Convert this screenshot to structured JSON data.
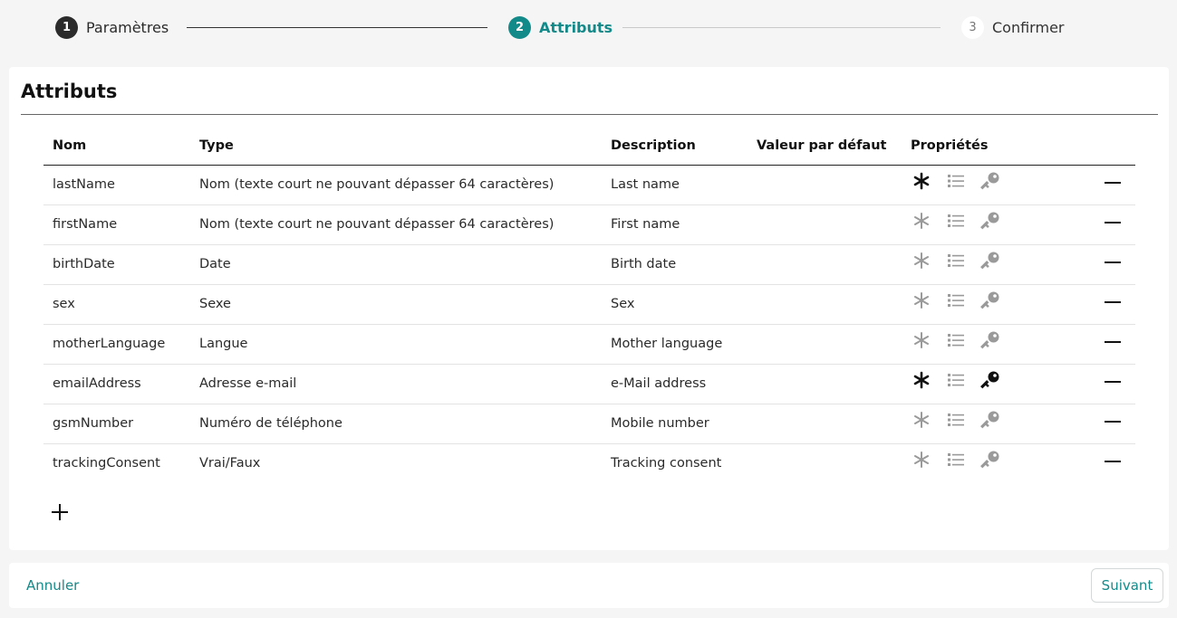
{
  "stepper": {
    "steps": [
      {
        "num": "1",
        "label": "Paramètres",
        "state": "done"
      },
      {
        "num": "2",
        "label": "Attributs",
        "state": "active"
      },
      {
        "num": "3",
        "label": "Confirmer",
        "state": "todo"
      }
    ]
  },
  "card": {
    "title": "Attributs",
    "columns": {
      "name": "Nom",
      "type": "Type",
      "description": "Description",
      "default": "Valeur par défaut",
      "properties": "Propriétés"
    },
    "rows": [
      {
        "name": "lastName",
        "type": "Nom (texte court ne pouvant dépasser 64 caractères)",
        "description": "Last name",
        "default": "",
        "required": true,
        "multiple": false,
        "key": false
      },
      {
        "name": "firstName",
        "type": "Nom (texte court ne pouvant dépasser 64 caractères)",
        "description": "First name",
        "default": "",
        "required": false,
        "multiple": false,
        "key": false
      },
      {
        "name": "birthDate",
        "type": "Date",
        "description": "Birth date",
        "default": "",
        "required": false,
        "multiple": false,
        "key": false
      },
      {
        "name": "sex",
        "type": "Sexe",
        "description": "Sex",
        "default": "",
        "required": false,
        "multiple": false,
        "key": false
      },
      {
        "name": "motherLanguage",
        "type": "Langue",
        "description": "Mother language",
        "default": "",
        "required": false,
        "multiple": false,
        "key": false
      },
      {
        "name": "emailAddress",
        "type": "Adresse e-mail",
        "description": "e-Mail address",
        "default": "",
        "required": true,
        "multiple": false,
        "key": true
      },
      {
        "name": "gsmNumber",
        "type": "Numéro de téléphone",
        "description": "Mobile number",
        "default": "",
        "required": false,
        "multiple": false,
        "key": false
      },
      {
        "name": "trackingConsent",
        "type": "Vrai/Faux",
        "description": "Tracking consent",
        "default": "",
        "required": false,
        "multiple": false,
        "key": false
      }
    ]
  },
  "icons": {
    "required": "asterisk-icon",
    "multiple": "list-icon",
    "key": "key-icon",
    "remove": "minus-icon",
    "add": "plus-icon"
  },
  "colors": {
    "accent": "#138a8a",
    "active_icon": "#111111",
    "inactive_icon": "#9a9a9a"
  },
  "footer": {
    "cancel_label": "Annuler",
    "next_label": "Suivant"
  }
}
